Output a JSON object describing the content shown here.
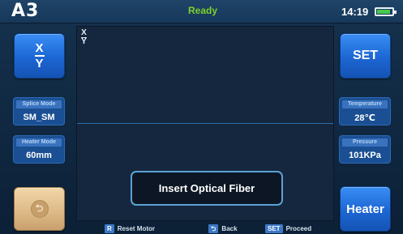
{
  "topbar": {
    "logo": "A3",
    "status": "Ready",
    "clock": "14:19",
    "battery_level": 0.78
  },
  "left": {
    "xy_button": {
      "top": "X",
      "bottom": "Y"
    },
    "splice_mode": {
      "label": "Splice Mode",
      "value": "SM_SM"
    },
    "heater_mode": {
      "label": "Heater Mode",
      "value": "60mm"
    },
    "back_icon": "undo-icon"
  },
  "right": {
    "set_label": "SET",
    "temperature": {
      "label": "Temperature",
      "value": "28℃"
    },
    "pressure": {
      "label": "Pressure",
      "value": "101KPa"
    },
    "heater_label": "Heater"
  },
  "view": {
    "axis_top": "X",
    "axis_bottom": "Y",
    "message": "Insert Optical Fiber"
  },
  "footer": {
    "reset": {
      "key": "R",
      "text": "Reset Motor"
    },
    "back": {
      "key": "⮌",
      "text": "Back"
    },
    "proceed": {
      "key": "SET",
      "text": "Proceed"
    }
  },
  "colors": {
    "accent": "#1c66d3",
    "status": "#7fd12b",
    "background": "#0f2740"
  }
}
